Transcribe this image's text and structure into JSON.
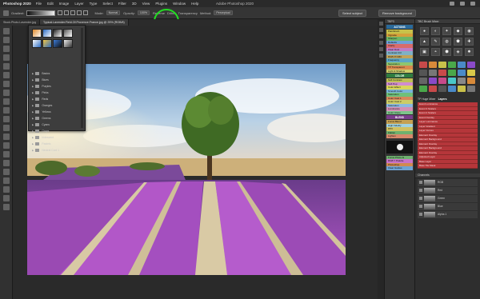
{
  "menubar": {
    "app_name": "Photoshop 2020",
    "items": [
      "File",
      "Edit",
      "Image",
      "Layer",
      "Type",
      "Select",
      "Filter",
      "3D",
      "View",
      "Plugins",
      "Window",
      "Help"
    ],
    "window_title": "Adobe Photoshop 2020"
  },
  "options_bar": {
    "gradient_label": "Gradient:",
    "mode_label": "Mode:",
    "mode_value": "Normal",
    "opacity_label": "Opacity:",
    "opacity_value": "100%",
    "reverse_label": "Reverse",
    "dither_label": "Dither",
    "transparency_label": "Transparency",
    "method_label": "Method:",
    "method_value": "Perceptual",
    "select_subject": "Select subject",
    "remove_background": "Remove background"
  },
  "tabs": [
    {
      "label": "Stock.Photo.Lavender.jpg",
      "active": false
    },
    {
      "label": "Typical.Lavender.Field.Of.Provence.France.jpg @ 25% (RGB/8)",
      "active": true
    }
  ],
  "gradient_popup": {
    "folders": [
      "Basics",
      "Blues",
      "Purples",
      "Pinks",
      "Reds",
      "Oranges",
      "Yellows",
      "Greens",
      "Cyans",
      "Grays",
      "Iridescent",
      "Pastels",
      "Neutral Cool 1"
    ]
  },
  "panels": {
    "actions_title": "TBP3",
    "actions_header": "ACTIONS",
    "actions": [
      {
        "label": "Paintbrush",
        "color": "#c8c24a"
      },
      {
        "label": "Vignette",
        "color": "#d5a03a"
      },
      {
        "label": "Sharpen",
        "color": "#6eb565"
      },
      {
        "label": "Defaults",
        "color": "#6fa1d6"
      },
      {
        "label": "Clarify",
        "color": "#d96b6b"
      },
      {
        "label": "Clear Dust",
        "color": "#c07cc5"
      },
      {
        "label": "Contrast Ctrl",
        "color": "#7fb1c6"
      },
      {
        "label": "RGB i/f CMC",
        "color": "#c2a35a"
      },
      {
        "label": "Frequency",
        "color": "#5da7c6"
      },
      {
        "label": "Separation",
        "color": "#8fc66e"
      },
      {
        "label": "TP Transparent",
        "color": "#d98a4e"
      },
      {
        "label": "Light & Shadow",
        "color": "#cfcf6a"
      }
    ],
    "color_header": "COLOR",
    "color_actions": [
      {
        "label": "Soft Contrast",
        "color": "#bfbf55"
      },
      {
        "label": "Soft Pop",
        "color": "#d08cd0"
      },
      {
        "label": "Color Effect",
        "color": "#d9d65a"
      },
      {
        "label": "Smooth Color",
        "color": "#7ab4d8"
      },
      {
        "label": "Saturation",
        "color": "#6fc07a"
      },
      {
        "label": "Color Cast 1",
        "color": "#d6885a"
      },
      {
        "label": "Color Cast 2",
        "color": "#cccc66"
      },
      {
        "label": "Saturation",
        "color": "#8ab8e0"
      },
      {
        "label": "Luminance",
        "color": "#d28fb5"
      },
      {
        "label": "Color Clone",
        "color": "#7cc48a"
      }
    ],
    "blend_header": "BLEND",
    "blend_actions": [
      {
        "label": "Focus Blend",
        "color": "#c6a152"
      },
      {
        "label": "High Fidelity",
        "color": "#9fd2e0"
      },
      {
        "label": "PPV",
        "color": "#d0c060"
      },
      {
        "label": "Flatten",
        "color": "#6fb16f"
      },
      {
        "label": "Lighten",
        "color": "#d9886a"
      }
    ],
    "nav_actions": [
      {
        "label": "Focus Photo Al",
        "color": "#6fb06f"
      },
      {
        "label": "RGB Y Palette",
        "color": "#c873c8"
      },
      {
        "label": "Photoshop",
        "color": "#d08a50"
      },
      {
        "label": "Clear Guides",
        "color": "#6ea3d3"
      }
    ],
    "tabs_label": "TBC Brush Mixer",
    "layers_tab": "Layers",
    "history_tab": "TP Huge Mixer",
    "layers": [
      "Event Luminance",
      "Event 3 Scalers",
      "Event 2 Scalers",
      "Event Overlay",
      "Layer Luminance",
      "Layer Gradient",
      "Layer Curves",
      "Element Overlay",
      "Element Background",
      "Element Overlay",
      "Element Background",
      "Element Overlay",
      "Adjusted Layer",
      "Base Layer",
      "Base Tile Mask"
    ],
    "channels_label": "Channels",
    "channels": [
      "RGB",
      "Red",
      "Green",
      "Blue",
      "Alpha 1"
    ]
  }
}
